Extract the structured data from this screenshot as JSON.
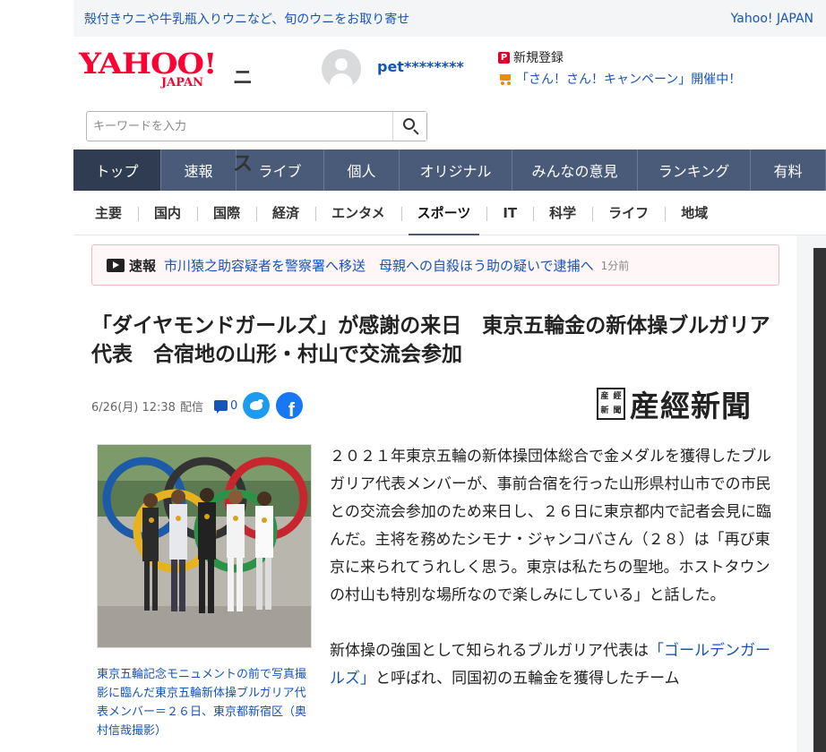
{
  "promo": {
    "text": "殻付きウニや牛乳瓶入りウニなど、旬のウニをお取り寄せ",
    "site_link": "Yahoo! JAPAN"
  },
  "header": {
    "logo_main": "YAHOO!",
    "logo_sub": "JAPAN",
    "logo_section": "ニュース",
    "username": "pet********",
    "register_label": "新規登録",
    "register_badge": "P",
    "campaign_text": "「さん！さん！キャンペーン」開催中！"
  },
  "search": {
    "placeholder": "キーワードを入力"
  },
  "main_nav": [
    {
      "label": "トップ",
      "active": true
    },
    {
      "label": "速報"
    },
    {
      "label": "ライブ"
    },
    {
      "label": "個人"
    },
    {
      "label": "オリジナル"
    },
    {
      "label": "みんなの意見"
    },
    {
      "label": "ランキング"
    },
    {
      "label": "有料"
    }
  ],
  "category_nav": [
    {
      "label": "主要"
    },
    {
      "label": "国内"
    },
    {
      "label": "国際"
    },
    {
      "label": "経済"
    },
    {
      "label": "エンタメ"
    },
    {
      "label": "スポーツ",
      "active": true
    },
    {
      "label": "IT"
    },
    {
      "label": "科学"
    },
    {
      "label": "ライフ"
    },
    {
      "label": "地域"
    }
  ],
  "breaking": {
    "label": "速報",
    "text": "市川猿之助容疑者を警察署へ移送　母親への自殺ほう助の疑いで逮捕へ",
    "time": "1分前"
  },
  "article": {
    "title": "「ダイヤモンドガールズ」が感謝の来日　東京五輪金の新体操ブルガリア代表　合宿地の山形・村山で交流会参加",
    "date": "6/26(月) 12:38",
    "date_suffix": "配信",
    "comment_count": "0",
    "publisher": "産經新聞",
    "publisher_seal": [
      "産",
      "經",
      "新",
      "聞"
    ],
    "photo_caption": "東京五輪記念モニュメントの前で写真撮影に臨んだ東京五輪新体操ブルガリア代表メンバー＝２６日、東京都新宿区（奥村信哉撮影）",
    "paragraph1": "２０２１年東京五輪の新体操団体総合で金メダルを獲得したブルガリア代表メンバーが、事前合宿を行った山形県村山市での市民との交流会参加のため来日し、２６日に東京都内で記者会見に臨んだ。主将を務めたシモナ・ジャンコバさん（２８）は「再び東京に来られてうれしく思う。東京は私たちの聖地。ホストタウンの村山も特別な場所なので楽しみにしている」と話した。",
    "paragraph2_start": "新体操の強国として知られるブルガリア代表は",
    "paragraph2_link": "「ゴールデンガールズ」",
    "paragraph2_end": "と呼ばれ、同国初の五輪金を獲得したチーム"
  },
  "colors": {
    "brand_red": "#ff0033",
    "nav_bg": "#4a5b79",
    "link_blue": "#1654b8",
    "twitter": "#1d9bf0",
    "facebook": "#1877f2"
  }
}
